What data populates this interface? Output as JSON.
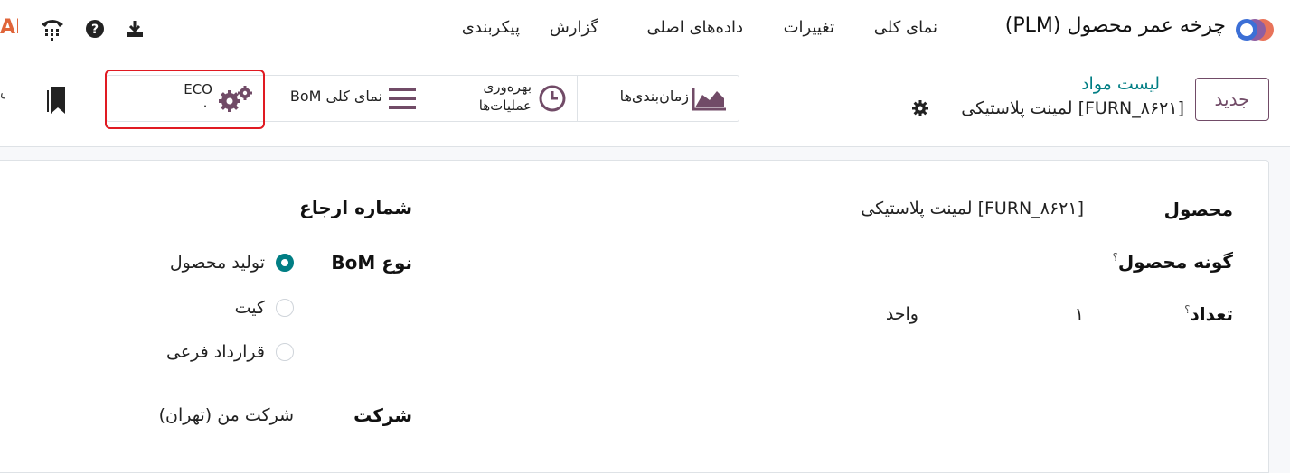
{
  "app": {
    "title": "چرخه عمر محصول (PLM)",
    "menu": [
      {
        "label": "نمای کلی"
      },
      {
        "label": "تغییرات"
      },
      {
        "label": "داده‌های اصلی"
      },
      {
        "label": "گزارش"
      },
      {
        "label": "پیکربندی"
      }
    ],
    "ai_fragment": "AI",
    "left_edge_char": "س",
    "icons": {
      "logo": "odoo-logo-icon",
      "download": "download-icon",
      "help": "help-icon",
      "phone": "phone-icon",
      "bookmark": "bookmark-icon"
    }
  },
  "control": {
    "new_button": "جدید",
    "breadcrumb": "لیست مواد",
    "record_title": "[FURN_۸۶۲۱] لمینت پلاستیکی",
    "smart_buttons": {
      "eco_label": "ECO",
      "eco_count": "۰",
      "bom_overview": "نمای کلی BoM",
      "operations_line1": "بهره‌وری",
      "operations_line2": "عملیات‌ها",
      "schedules": "زمان‌بندی‌ها"
    }
  },
  "form": {
    "product_label": "محصول",
    "product_value": "[FURN_۸۶۲۱] لمینت پلاستیکی",
    "variant_label": "گونه محصول",
    "quantity_label": "تعداد",
    "quantity_value": "۱",
    "uom_value": "واحد",
    "help_mark": "؟",
    "reference_label": "شماره ارجاع",
    "bom_type_label": "نوع BoM",
    "bom_type_options": [
      {
        "label": "تولید محصول",
        "checked": true
      },
      {
        "label": "کیت",
        "checked": false
      },
      {
        "label": "قرارداد فرعی",
        "checked": false
      }
    ],
    "company_label": "شرکت",
    "company_value": "شرکت من (تهران)"
  },
  "colors": {
    "brand": "#714b67",
    "accent": "#017e84",
    "highlight": "#e01a22"
  }
}
